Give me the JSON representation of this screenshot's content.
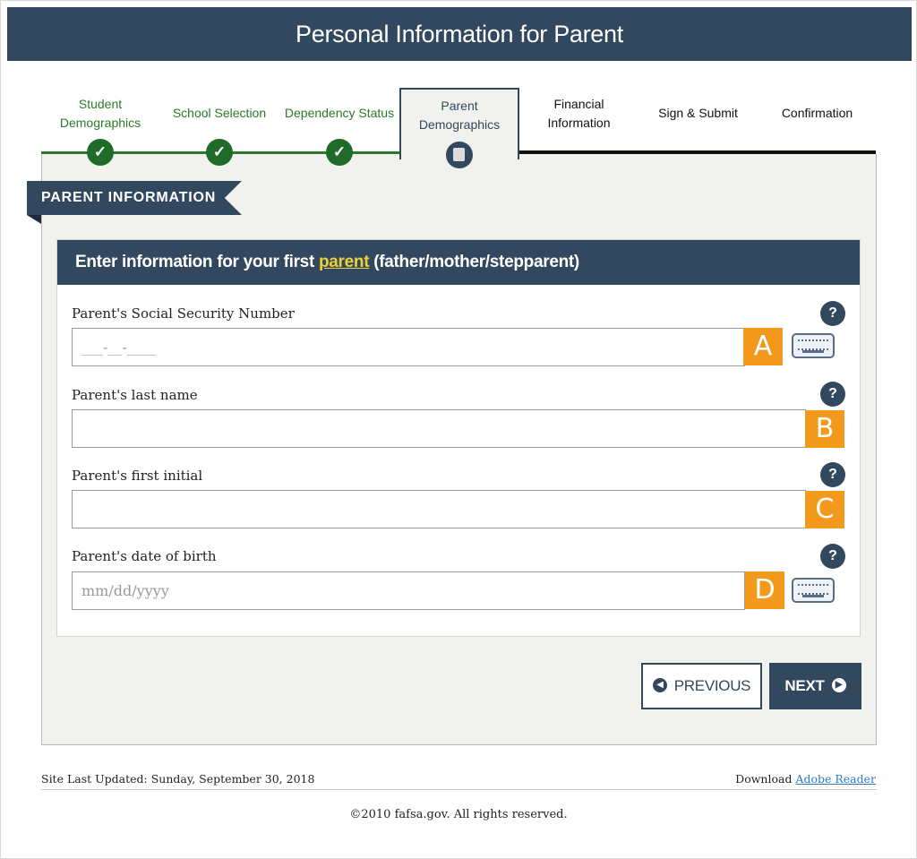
{
  "header": {
    "title": "Personal Information for Parent"
  },
  "steps": [
    {
      "label": "Student Demographics",
      "state": "done"
    },
    {
      "label": "School Selection",
      "state": "done"
    },
    {
      "label": "Dependency Status",
      "state": "done"
    },
    {
      "label": "Parent Demographics",
      "state": "current"
    },
    {
      "label": "Financial Information",
      "state": "todo"
    },
    {
      "label": "Sign & Submit",
      "state": "todo"
    },
    {
      "label": "Confirmation",
      "state": "todo"
    }
  ],
  "section": {
    "title": "PARENT INFORMATION"
  },
  "card": {
    "heading_prefix": "Enter information for your first ",
    "heading_link": "parent",
    "heading_suffix": " (father/mother/stepparent)"
  },
  "fields": {
    "ssn": {
      "label": "Parent's Social Security Number",
      "placeholder": "___-__-____",
      "marker": "A"
    },
    "last_name": {
      "label": "Parent's last name",
      "placeholder": "",
      "marker": "B"
    },
    "first_initial": {
      "label": "Parent's first initial",
      "placeholder": "",
      "marker": "C"
    },
    "dob": {
      "label": "Parent's date of birth",
      "placeholder": "mm/dd/yyyy",
      "marker": "D"
    }
  },
  "help_symbol": "?",
  "buttons": {
    "previous": "PREVIOUS",
    "next": "NEXT"
  },
  "footer": {
    "updated": "Site Last Updated: Sunday, September 30, 2018",
    "download_prefix": "Download ",
    "download_link": "Adobe Reader",
    "copyright": "©2010 fafsa.gov. All rights reserved."
  },
  "colors": {
    "brand": "#32485f",
    "done": "#1f6b2a",
    "marker": "#f39a1c",
    "link": "#2f7bbf"
  }
}
